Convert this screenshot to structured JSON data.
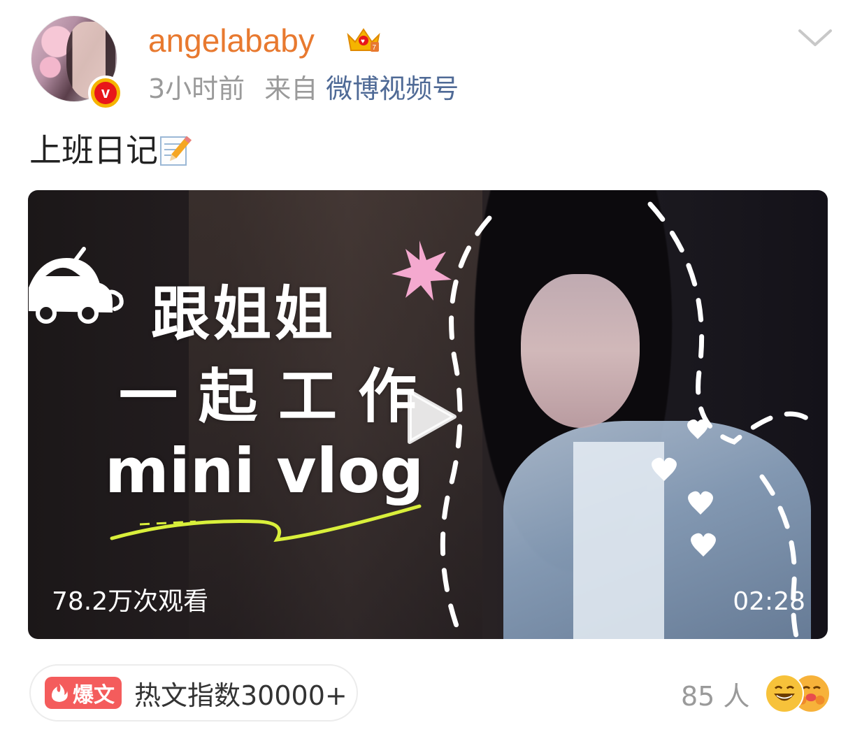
{
  "post": {
    "username": "angelababy",
    "time": "3小时前",
    "from_label": "来自",
    "source": "微博视频号",
    "text": "上班日记"
  },
  "video": {
    "title_line_1": "跟姐姐",
    "title_line_2": "一起工作",
    "title_line_3": "mini vlog",
    "views": "78.2万次观看",
    "duration": "02:28"
  },
  "footer": {
    "hot_badge": "爆文",
    "hot_text": "热文指数30000+",
    "reaction_count": "85 人"
  },
  "colors": {
    "username": "#e8792f",
    "source_link": "#4f6a96",
    "hot_badge": "#f45c5c",
    "meta_gray": "#9a9a9a"
  },
  "icons": {
    "verified": "verified-v-badge-icon",
    "crown": "crown-member-icon",
    "chevron": "chevron-down-icon",
    "memo": "memo-pencil-icon",
    "play": "play-icon",
    "fire": "fire-icon",
    "emoji_1": "laughing-face-icon",
    "emoji_2": "hugging-face-icon"
  }
}
